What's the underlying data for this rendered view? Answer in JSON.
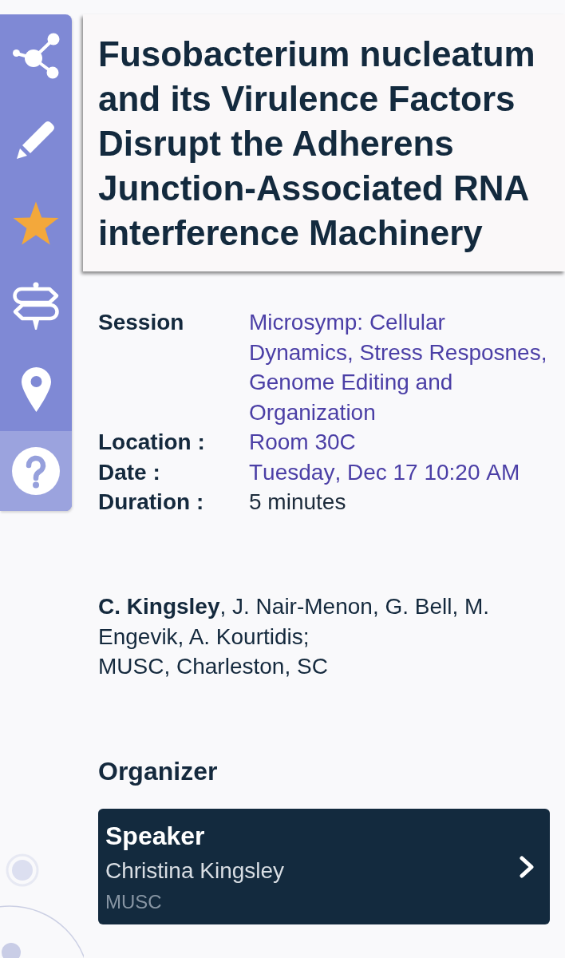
{
  "sidebar": {
    "favorite": true
  },
  "title": "Fusobacterium nucleatum and its Virulence Factors Disrupt the Adherens Junction-Associated RNA interference Machinery",
  "details": [
    {
      "label": "Session",
      "value": "Microsymp: Cellular Dynamics, Stress Resposnes, Genome Editing and Organization",
      "kind": "link"
    },
    {
      "label": "Location :",
      "value": "Room 30C",
      "kind": "link"
    },
    {
      "label": "Date :",
      "value": "Tuesday, Dec 17 10:20 AM",
      "kind": "link"
    },
    {
      "label": "Duration :",
      "value": "5 minutes",
      "kind": "text"
    }
  ],
  "authors": "**C. Kingsley**, J. Nair-Menon, G. Bell, M. Engevik, A. Kourtidis;",
  "affiliation": "MUSC, Charleston, SC",
  "organizer": {
    "heading": "Organizer",
    "people": [
      {
        "role": "Speaker",
        "name": "Christina Kingsley",
        "institution": "MUSC"
      }
    ]
  }
}
